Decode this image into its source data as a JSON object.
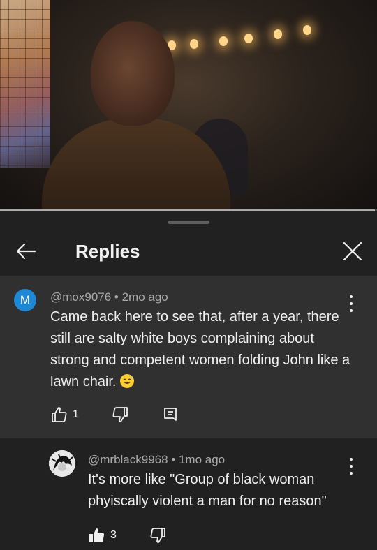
{
  "video": {
    "progress_fraction": 0.995
  },
  "panel": {
    "title": "Replies"
  },
  "comments": [
    {
      "avatar_letter": "M",
      "avatar_color": "#1e88d5",
      "meta": "@mox9076 • 2mo ago",
      "text": "Came back here to see that, after a year, there still are salty white boys complaining about strong and competent women folding John like a lawn chair.",
      "emoji": "grinning-sweat-emoji",
      "likes": "1"
    },
    {
      "meta": "@mrblack9968 • 1mo ago",
      "text": "It's more like \"Group of black woman phyiscally violent a man for no reason\"",
      "likes": "3"
    }
  ],
  "icons": {
    "back": "arrow-left-icon",
    "close": "close-icon",
    "more": "more-vert-icon",
    "like": "thumbs-up-icon",
    "dislike": "thumbs-down-icon",
    "reply": "comment-icon"
  }
}
